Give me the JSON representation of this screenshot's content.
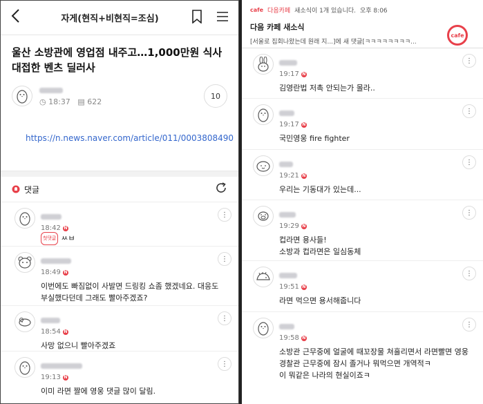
{
  "left": {
    "topbar": {
      "back_glyph": "〈",
      "title": "자게(현직+비현직=조심)"
    },
    "article": {
      "headline": "울산 소방관에 영업점 내주고…1,000만원 식사 대접한 벤츠 딜러사",
      "time": "18:37",
      "views": "622",
      "comment_count": "10",
      "link": "https://n.news.naver.com/article/011/0003808490"
    },
    "comments_header": {
      "label": "댓글"
    },
    "comments": [
      {
        "time": "18:42",
        "badge": "첫댓글",
        "text": "ㅆㅂ",
        "avatar": "penguin-avatar-icon"
      },
      {
        "time": "18:49",
        "text": "이번에도 빠짐없이 사발면 드링킹 쇼좀 했겠네요. 대응도 부실했다던데 그래도 빨아주겠죠?",
        "avatar": "bear-avatar-icon"
      },
      {
        "time": "18:54",
        "text": "사망 없으니 빨아주겠죠",
        "avatar": "rat-avatar-icon"
      },
      {
        "time": "19:13",
        "text": "이미 라면 짤에 영웅 댓글 많이 달림.",
        "avatar": "penguin-avatar-icon"
      }
    ]
  },
  "right": {
    "notification": {
      "brand": "cafe",
      "app": "다음카페",
      "summary": "새소식이 1개 있습니다.",
      "time": "오후 8:06",
      "title": "다음 카페 새소식",
      "body": "[서울로 집회나왔는데 원래 지...]에 새 댓글[ㅋㅋㅋㅋㅋㅋㅋㅋ...",
      "logo": "cafe"
    },
    "comments": [
      {
        "time": "19:17",
        "text": "김영란법 저촉 안되는가 몰라..",
        "avatar": "rabbit-avatar-icon"
      },
      {
        "time": "19:17",
        "text": "국민영웅 fire fighter",
        "avatar": "penguin-avatar-icon"
      },
      {
        "time": "19:21",
        "text": "우리는 기동대가 있는데...",
        "avatar": "blob-avatar-icon"
      },
      {
        "time": "19:29",
        "text": "컵라면 용사들!\n소방과 컵라면은 일심동체",
        "avatar": "pig-avatar-icon"
      },
      {
        "time": "19:51",
        "text": "라면 먹으면 용서해줍니다",
        "avatar": "hedgehog-avatar-icon"
      },
      {
        "time": "19:58",
        "text": "소방관 근무중에 얼굴에 때꼬장물 쳐흘리면서 라면빨면 영웅\n경찰관 근무중에 잠시 졸거나 뭐먹으면 개역적ㅋ\n이 뭐같은 나라의 현실이죠ㅋ",
        "avatar": "penguin-avatar-icon"
      }
    ]
  },
  "colors": {
    "accent_red": "#e8404a",
    "link_blue": "#3366cc"
  }
}
